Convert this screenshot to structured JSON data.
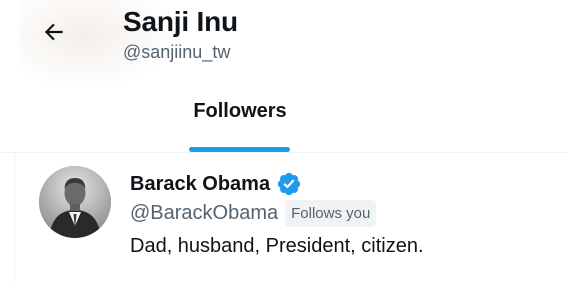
{
  "header": {
    "title": "Sanji Inu",
    "handle": "@sanjiinu_tw",
    "back_icon": "arrow-left-icon"
  },
  "tabs": [
    {
      "label": "Followers",
      "active": true
    }
  ],
  "accent_color": "#1d9bf0",
  "user": {
    "name": "Barack Obama",
    "handle": "@BarackObama",
    "verified": true,
    "verified_icon": "verified-badge-icon",
    "follows_you_label": "Follows you",
    "bio": "Dad, husband, President, citizen."
  }
}
